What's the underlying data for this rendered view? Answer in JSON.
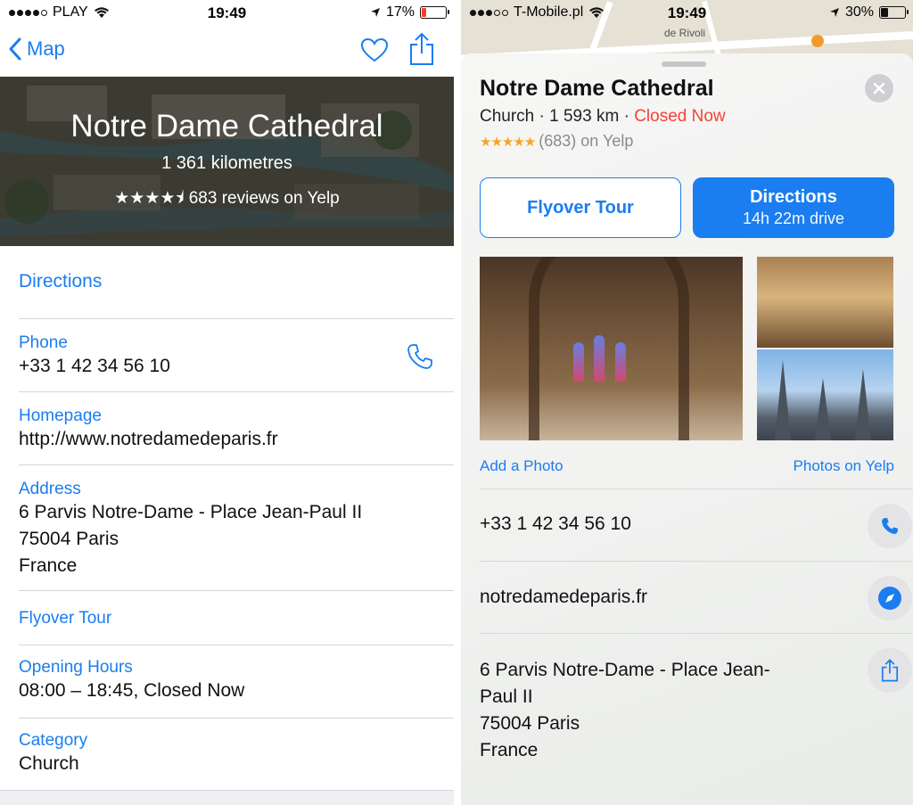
{
  "left": {
    "status": {
      "carrier": "PLAY",
      "time": "19:49",
      "battery": "17%",
      "battery_level": 0.17,
      "battery_color": "#ff3b30"
    },
    "nav": {
      "back_label": "Map",
      "heart_icon": "heart-icon",
      "share_icon": "share-icon"
    },
    "hero": {
      "title": "Notre Dame Cathedral",
      "distance": "1 361 kilometres",
      "stars": "★★★★⯨",
      "reviews": "683 reviews on Yelp"
    },
    "rows": {
      "directions": "Directions",
      "phone_label": "Phone",
      "phone_value": "+33 1 42 34 56 10",
      "homepage_label": "Homepage",
      "homepage_value": "http://www.notredamedeparis.fr",
      "address_label": "Address",
      "address_lines": [
        "6 Parvis Notre-Dame - Place Jean-Paul II",
        "75004 Paris",
        "France"
      ],
      "flyover": "Flyover Tour",
      "hours_label": "Opening Hours",
      "hours_value": "08:00 – 18:45, Closed Now",
      "category_label": "Category",
      "category_value": "Church"
    }
  },
  "right": {
    "status": {
      "carrier": "T-Mobile.pl",
      "time": "19:49",
      "battery": "30%",
      "battery_level": 0.3,
      "battery_color": "#111111"
    },
    "map_labels": [
      "de Rivoli"
    ],
    "card": {
      "name": "Notre Dame Cathedral",
      "category": "Church",
      "distance": "1 593 km",
      "status": "Closed Now",
      "status_color": "#f44336",
      "stars": "★★★★★",
      "rating": "(683) on Yelp",
      "flyover_button": "Flyover Tour",
      "directions_button": "Directions",
      "directions_sub": "14h 22m drive",
      "add_photo": "Add a Photo",
      "photos_yelp": "Photos on Yelp",
      "phone": "+33 1 42 34 56 10",
      "website": "notredamedeparis.fr",
      "address_lines": [
        "6 Parvis Notre-Dame - Place Jean-",
        "Paul II",
        "75004 Paris",
        "France"
      ]
    }
  },
  "colors": {
    "accent": "#1a7df0",
    "separator": "#d5d5d8"
  }
}
